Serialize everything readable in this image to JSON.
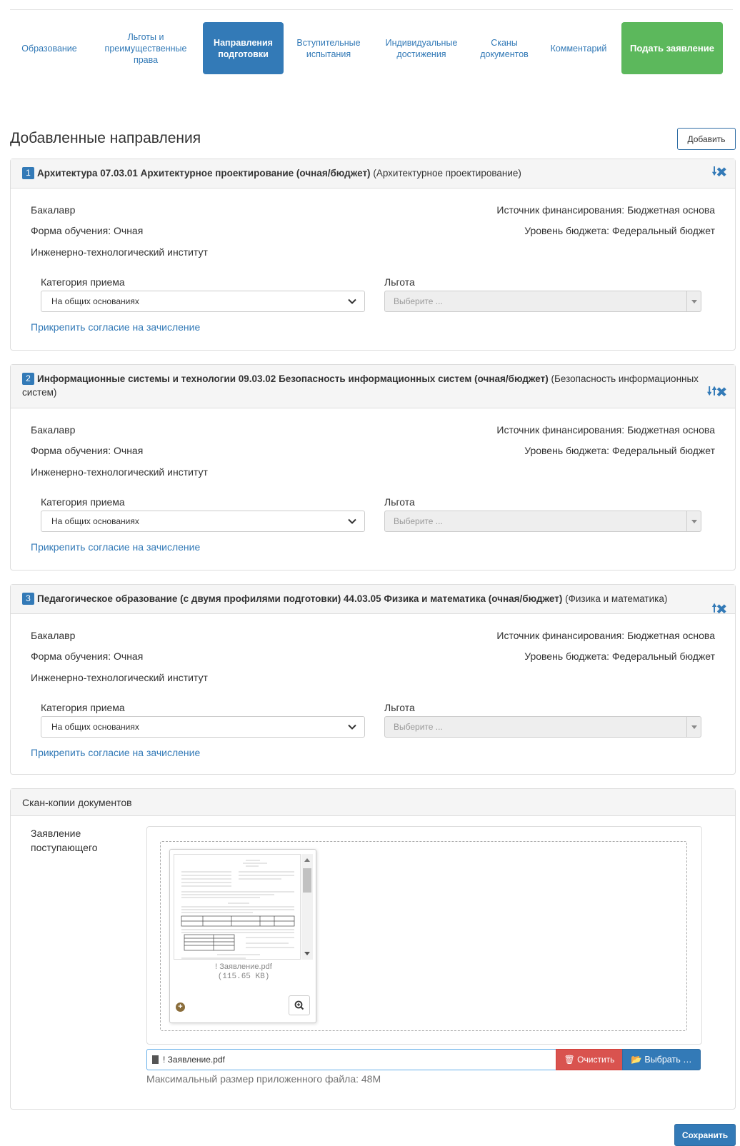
{
  "nav": {
    "tabs": [
      {
        "label": "Образование"
      },
      {
        "label": "Льготы и преимущественные права"
      },
      {
        "label": "Направления подготовки"
      },
      {
        "label": "Вступительные испытания"
      },
      {
        "label": "Индивидуальные достижения"
      },
      {
        "label": "Сканы документов"
      },
      {
        "label": "Комментарий"
      }
    ],
    "submit_label": "Подать заявление"
  },
  "section": {
    "title": "Добавленные направления",
    "add_label": "Добавить"
  },
  "directions": [
    {
      "num": "1",
      "title": "Архитектура 07.03.01 Архитектурное проектирование (очная/бюджет)",
      "profile": "(Архитектурное проектирование)",
      "level": "Бакалавр",
      "form": "Форма обучения: Очная",
      "institute": "Инженерно-технологический институт",
      "funding": "Источник финансирования: Бюджетная основа",
      "budget": "Уровень бюджета: Федеральный бюджет",
      "category_label": "Категория приема",
      "category_value": "На общих основаниях",
      "benefit_label": "Льгота",
      "benefit_placeholder": "Выберите ...",
      "consent_link": "Прикрепить согласие на зачисление"
    },
    {
      "num": "2",
      "title": "Информационные системы и технологии 09.03.02 Безопасность информационных систем (очная/бюджет)",
      "profile": "(Безопасность информационных систем)",
      "level": "Бакалавр",
      "form": "Форма обучения: Очная",
      "institute": "Инженерно-технологический институт",
      "funding": "Источник финансирования: Бюджетная основа",
      "budget": "Уровень бюджета: Федеральный бюджет",
      "category_label": "Категория приема",
      "category_value": "На общих основаниях",
      "benefit_label": "Льгота",
      "benefit_placeholder": "Выберите ...",
      "consent_link": "Прикрепить согласие на зачисление"
    },
    {
      "num": "3",
      "title": "Педагогическое образование (с двумя профилями подготовки) 44.03.05 Физика и математика (очная/бюджет)",
      "profile": "(Физика и математика)",
      "level": "Бакалавр",
      "form": "Форма обучения: Очная",
      "institute": "Инженерно-технологический институт",
      "funding": "Источник финансирования: Бюджетная основа",
      "budget": "Уровень бюджета: Федеральный бюджет",
      "category_label": "Категория приема",
      "category_value": "На общих основаниях",
      "benefit_label": "Льгота",
      "benefit_placeholder": "Выберите ...",
      "consent_link": "Прикрепить согласие на зачисление"
    }
  ],
  "scans": {
    "heading": "Скан-копии документов",
    "doc_label": "Заявление поступающего",
    "file_name": "! Заявление.pdf",
    "file_size": "(115.65 KB)",
    "input_value": "! Заявление.pdf",
    "clear_label": "Очистить",
    "browse_label": "Выбрать …",
    "max_size": "Максимальный размер приложенного файла: 48M"
  },
  "save_label": "Сохранить",
  "colors": {
    "primary": "#337ab7",
    "success": "#5cb85c",
    "danger": "#d9534f"
  },
  "icons": {
    "move_down": "arrow-down-icon",
    "move_up": "arrow-up-icon",
    "remove": "close-icon",
    "file": "file-icon",
    "trash": "trash-icon",
    "folder": "folder-open-icon",
    "zoom": "zoom-in-icon",
    "expand": "plus-circle-icon"
  }
}
